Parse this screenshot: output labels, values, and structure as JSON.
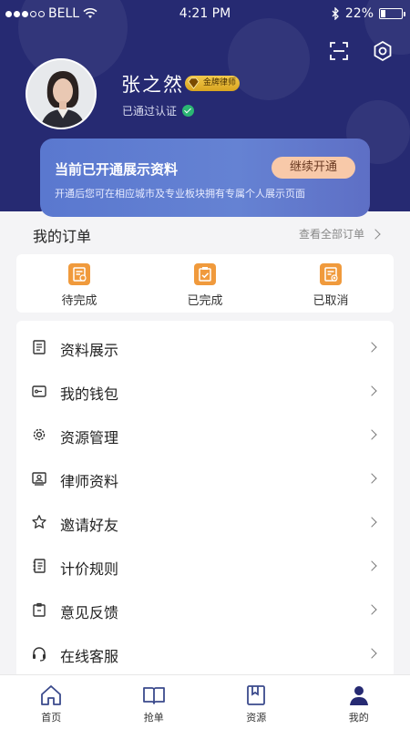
{
  "status": {
    "carrier": "BELL",
    "time": "4:21 PM",
    "battery": "22%",
    "battery_level": 0.22
  },
  "profile": {
    "name": "张之然",
    "badge": "金牌律师",
    "verified": "已通过认证"
  },
  "promo": {
    "title": "当前已开通展示资料",
    "button": "继续开通",
    "desc": "开通后您可在相应城市及专业板块拥有专属个人展示页面"
  },
  "orders": {
    "title": "我的订单",
    "view_all": "查看全部订单",
    "items": [
      {
        "label": "待完成",
        "icon": "pending-order-icon"
      },
      {
        "label": "已完成",
        "icon": "completed-order-icon"
      },
      {
        "label": "已取消",
        "icon": "cancelled-order-icon"
      }
    ]
  },
  "menu": [
    {
      "label": "资料展示",
      "icon": "document-list-icon"
    },
    {
      "label": "我的钱包",
      "icon": "wallet-icon"
    },
    {
      "label": "资源管理",
      "icon": "gear-icon"
    },
    {
      "label": "律师资料",
      "icon": "id-card-icon"
    },
    {
      "label": "邀请好友",
      "icon": "star-icon"
    },
    {
      "label": "计价规则",
      "icon": "rules-book-icon"
    },
    {
      "label": "意见反馈",
      "icon": "feedback-icon"
    },
    {
      "label": "在线客服",
      "icon": "headset-icon"
    }
  ],
  "tabs": [
    {
      "label": "首页",
      "icon": "home-icon"
    },
    {
      "label": "抢单",
      "icon": "book-icon"
    },
    {
      "label": "资源",
      "icon": "bookmark-icon"
    },
    {
      "label": "我的",
      "icon": "user-icon",
      "active": true
    }
  ],
  "colors": {
    "header": "#262a72",
    "accent": "#f09a3c",
    "promo_button": "#f8c9a9"
  }
}
